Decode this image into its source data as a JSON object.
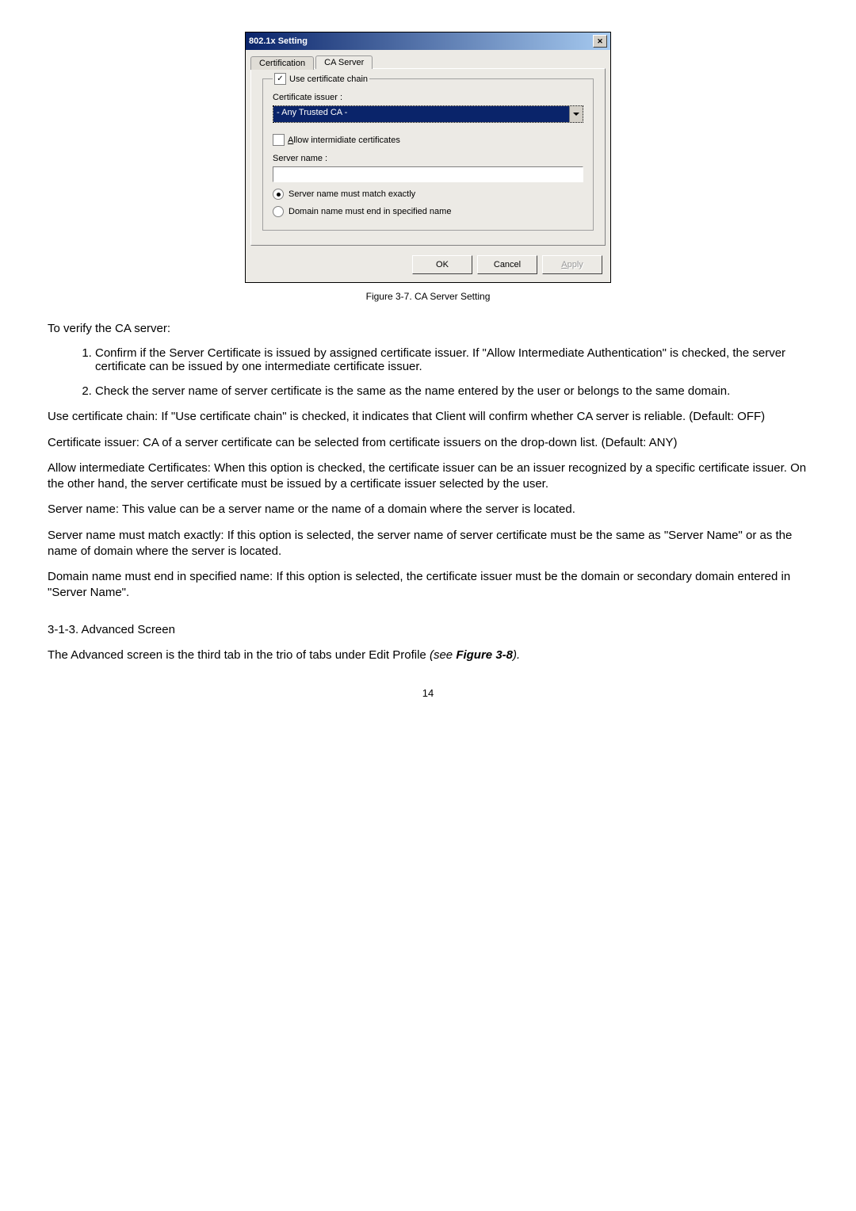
{
  "dialog": {
    "title": "802.1x Setting",
    "close_icon": "✕",
    "tabs": {
      "inactive": "Certification",
      "active": "CA Server"
    },
    "use_cert_chain_label": "Use certificate chain",
    "use_cert_chain_checked": "✓",
    "cert_issuer_label": "Certificate issuer :",
    "cert_issuer_value": "- Any Trusted CA -",
    "allow_intermediate_label": "Allow intermidiate certificates",
    "allow_intermediate_underline": "A",
    "server_name_label": "Server name :",
    "radio1": "Server name must match exactly",
    "radio2": "Domain name must end in specified name",
    "buttons": {
      "ok": "OK",
      "cancel": "Cancel",
      "apply": "Apply"
    }
  },
  "figure_caption": "Figure 3-7.   CA Server Setting",
  "body": {
    "intro": "To verify the CA server:",
    "item1": "Confirm if the Server Certificate is issued by assigned certificate issuer. If \"Allow Intermediate Authentication\" is checked, the server certificate can be issued by one intermediate certificate issuer.",
    "item2": "Check the server name of server certificate is the same as the name entered by the user or belongs to the same domain.",
    "use_chain": "Use certificate chain:   If \"Use certificate chain\" is checked, it indicates that Client will confirm whether CA server is reliable. (Default: OFF)",
    "cert_issuer": "Certificate issuer:   CA of a server certificate can be selected from certificate issuers on the drop-down list. (Default: ANY)",
    "allow_inter": "Allow intermediate Certificates:     When this option is checked, the certificate issuer can be an issuer recognized by a specific certificate issuer. On the other hand, the server certificate must be issued by a certificate issuer selected by the user.",
    "server_name": "Server name:  This value can be a server name or the name of a domain where the server is located.",
    "match_exactly": "Server name must match exactly:    If this option is selected, the server name of server certificate must be the same as \"Server Name\" or as the name of domain where the server is located.",
    "domain_end": "Domain name must end in specified name:     If this option is selected, the certificate issuer must be the domain or secondary domain entered in \"Server Name\".",
    "subsection": "3-1-3.     Advanced Screen",
    "advanced": "The Advanced  screen is the third tab in the trio of tabs under Edit Profile ",
    "advanced_ref": "(see Figure 3-8).",
    "pagenum": "14"
  }
}
